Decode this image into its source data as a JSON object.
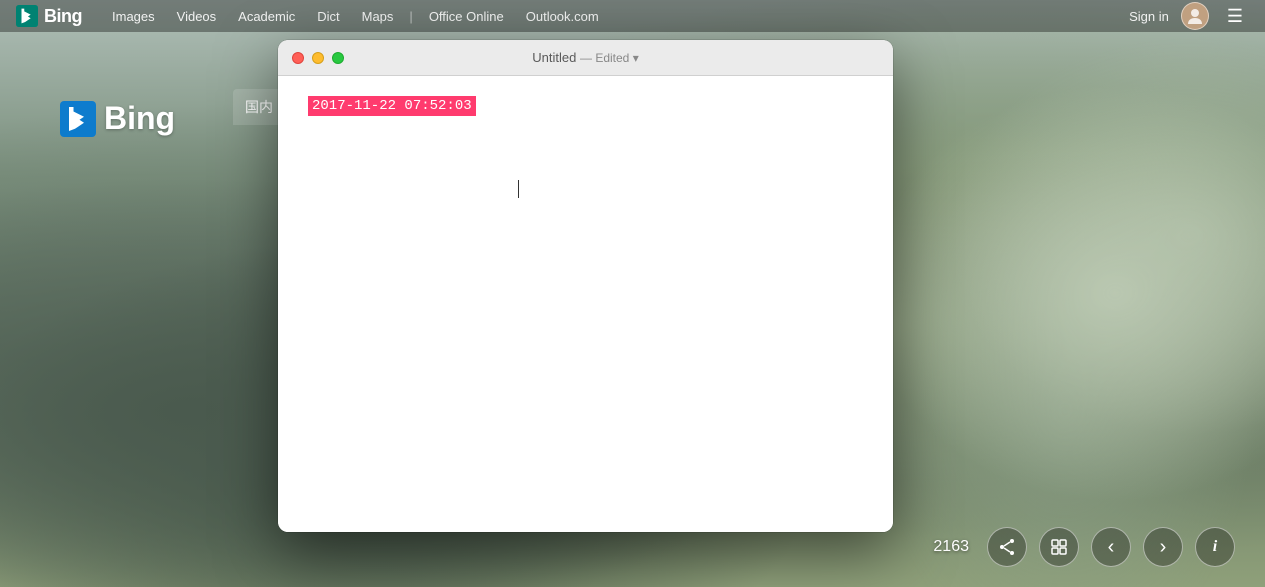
{
  "background": {
    "description": "Snowy mountain and forest landscape"
  },
  "topbar": {
    "nav_items": [
      {
        "label": "Images",
        "id": "images"
      },
      {
        "label": "Videos",
        "id": "videos"
      },
      {
        "label": "Academic",
        "id": "academic"
      },
      {
        "label": "Dict",
        "id": "dict"
      },
      {
        "label": "Maps",
        "id": "maps"
      },
      {
        "label": "Office Online",
        "id": "office-online"
      },
      {
        "label": "Outlook.com",
        "id": "outlook"
      }
    ],
    "sign_in_label": "Sign in",
    "menu_icon": "☰"
  },
  "bing_logo": {
    "text": "Bing"
  },
  "cn_tab": {
    "text": "国内"
  },
  "window": {
    "title": "Untitled",
    "edited_label": "— Edited",
    "dropdown_icon": "▾",
    "content_text": "2017-11-22 07:52:03"
  },
  "bottom_controls": {
    "image_count": "2163",
    "share_icon": "share",
    "grid_icon": "grid",
    "prev_icon": "‹",
    "next_icon": "›",
    "info_icon": "i"
  }
}
